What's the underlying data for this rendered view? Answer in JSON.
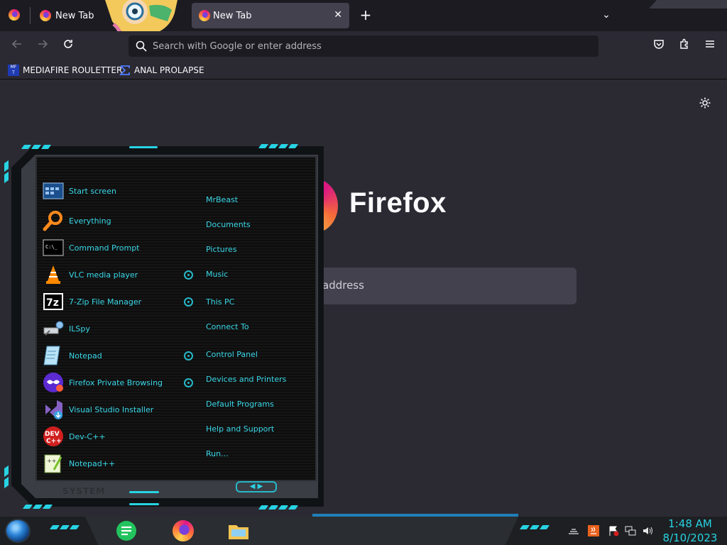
{
  "browser": {
    "tabs": [
      {
        "label": "New Tab",
        "active": false
      },
      {
        "label": "New Tab",
        "active": true,
        "close": "✕"
      }
    ],
    "new_tab_symbol": "+",
    "list_all_tabs_symbol": "⌄",
    "url_placeholder": "Search with Google or enter address",
    "bookmarks": [
      {
        "label": "MEDIAFIRE ROULETTER",
        "icon": "mediafire-icon"
      },
      {
        "label": "ANAL PROLAPSE",
        "icon": "sigma-icon"
      }
    ]
  },
  "newtab": {
    "brand": "Firefox",
    "search_placeholder_visible": "address"
  },
  "start_menu": {
    "programs": [
      {
        "label": "Start screen",
        "icon": "start-screen-icon"
      },
      {
        "label": "Everything",
        "icon": "magnifier-icon"
      },
      {
        "label": "Command Prompt",
        "icon": "cmd-icon"
      },
      {
        "label": "VLC media player",
        "icon": "vlc-cone-icon"
      },
      {
        "label": "7-Zip File Manager",
        "icon": "7zip-icon"
      },
      {
        "label": "ILSpy",
        "icon": "ilspy-icon"
      },
      {
        "label": "Notepad",
        "icon": "notepad-icon"
      },
      {
        "label": "Firefox Private Browsing",
        "icon": "private-browsing-icon"
      },
      {
        "label": "Visual Studio Installer",
        "icon": "vs-installer-icon"
      },
      {
        "label": "Dev-C++",
        "icon": "devcpp-icon"
      },
      {
        "label": "Notepad++",
        "icon": "notepadpp-icon"
      }
    ],
    "places": [
      {
        "label": "MrBeast",
        "has_submenu": false
      },
      {
        "label": "Documents",
        "has_submenu": false
      },
      {
        "label": "Pictures",
        "has_submenu": false
      },
      {
        "label": "Music",
        "has_submenu": false
      },
      {
        "label": "This PC",
        "has_submenu": false
      },
      {
        "label": "Connect To",
        "has_submenu": false
      },
      {
        "label": "Control Panel",
        "has_submenu": false
      },
      {
        "label": "Devices and Printers",
        "has_submenu": false
      },
      {
        "label": "Default Programs",
        "has_submenu": false
      },
      {
        "label": "Help and Support",
        "has_submenu": false
      },
      {
        "label": "Run...",
        "has_submenu": false
      }
    ],
    "footer_label": "SYSTEM",
    "accent": "#27d3e3",
    "text_color": "#39d7e8"
  },
  "taskbar": {
    "apps": [
      {
        "name": "notes-app-icon"
      },
      {
        "name": "firefox-icon"
      },
      {
        "name": "file-explorer-icon"
      }
    ],
    "clock": {
      "time": "1:48 AM",
      "date": "8/10/2023"
    }
  }
}
